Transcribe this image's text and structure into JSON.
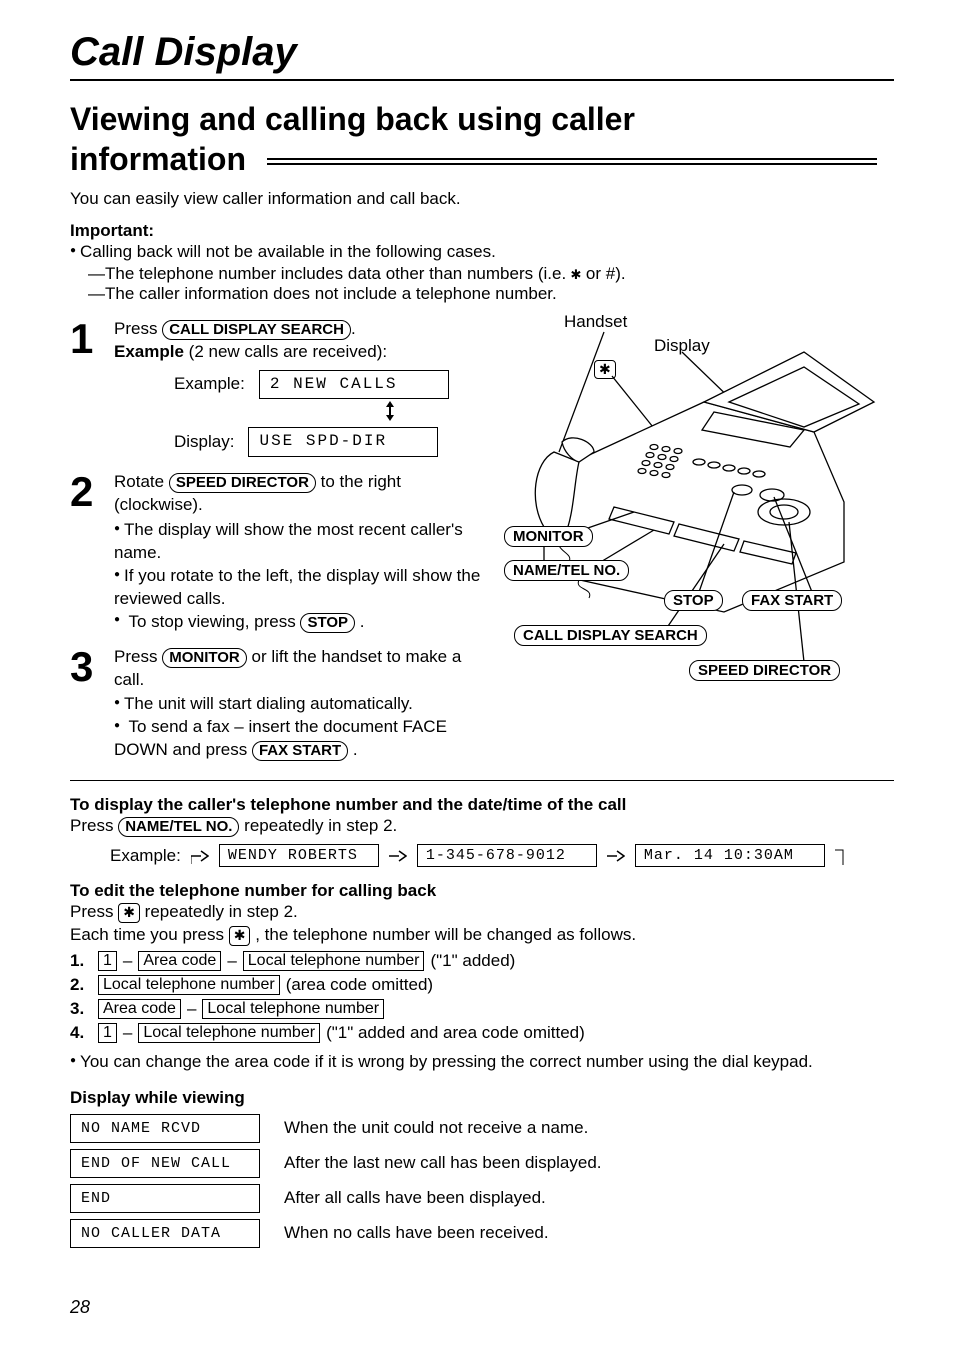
{
  "header": {
    "chapter": "Call Display",
    "section": "Viewing and calling back using caller information"
  },
  "intro": "You can easily view caller information and call back.",
  "important": {
    "label": "Important:",
    "lead": "Calling back will not be available in the following cases.",
    "c1": "—The telephone number includes data other than numbers (i.e.",
    "c1b": "or #).",
    "c2": "—The caller information does not include a telephone number."
  },
  "steps": {
    "s1": {
      "num": "1",
      "press": "Press",
      "key": "CALL DISPLAY SEARCH",
      "dot": ".",
      "exA": "Example",
      "exB": "(2 new calls are received):",
      "row1Label": "Example:",
      "row1Val": "2 NEW CALLS",
      "row2Label": "Display:",
      "row2Val": "USE SPD-DIR"
    },
    "s2": {
      "num": "2",
      "rotate": "Rotate",
      "key": "SPEED DIRECTOR",
      "tail": "to the right (clockwise).",
      "b1": "The display will show the most recent caller's name.",
      "b2": "If you rotate to the left, the display will show the reviewed calls.",
      "b3a": "To stop viewing, press",
      "b3key": "STOP",
      "b3dot": "."
    },
    "s3": {
      "num": "3",
      "a": "Press",
      "key": "MONITOR",
      "b": "or lift the handset to make a call.",
      "b1": "The unit will start dialing automatically.",
      "b2a": "To send a fax – insert the document FACE DOWN and press",
      "b2key": "FAX START",
      "b2dot": "."
    }
  },
  "device": {
    "handset": "Handset",
    "display": "Display",
    "star": "✱",
    "monitor": "MONITOR",
    "nametel": "NAME/TEL NO.",
    "stop": "STOP",
    "faxstart": "FAX START",
    "cds": "CALL DISPLAY SEARCH",
    "sd": "SPEED DIRECTOR"
  },
  "nameTel": {
    "title": "To display the caller's telephone number and the date/time of the call",
    "press": "Press",
    "key": "NAME/TEL NO.",
    "tail": "repeatedly in step 2.",
    "exLabel": "Example:",
    "v1": "WENDY ROBERTS",
    "v2": "1-345-678-9012",
    "v3": "Mar. 14 10:30AM"
  },
  "edit": {
    "title": "To edit the telephone number for calling back",
    "pressA": "Press",
    "pressB": "repeatedly in step 2.",
    "eachA": "Each time you press",
    "eachB": ", the telephone number will be changed as follows.",
    "star": "✱",
    "l1": {
      "n": "1.",
      "one": "1",
      "ac": "Area code",
      "ltn": "Local telephone number",
      "note": "(\"1\" added)"
    },
    "l2": {
      "n": "2.",
      "ltn": "Local telephone number",
      "note": "(area code omitted)"
    },
    "l3": {
      "n": "3.",
      "ac": "Area code",
      "ltn": "Local telephone number"
    },
    "l4": {
      "n": "4.",
      "one": "1",
      "ltn": "Local telephone number",
      "note": "(\"1\" added and area code omitted)"
    },
    "foot": "You can change the area code if it is wrong by pressing the correct number using the dial keypad."
  },
  "dispView": {
    "title": "Display while viewing",
    "r1box": "NO NAME RCVD",
    "r1txt": "When the unit could not receive a name.",
    "r2box": "END OF NEW CALL",
    "r2txt": "After the last new call has been displayed.",
    "r3box": "END",
    "r3txt": "After all calls have been displayed.",
    "r4box": "NO CALLER DATA",
    "r4txt": "When no calls have been received."
  },
  "pageNum": "28"
}
